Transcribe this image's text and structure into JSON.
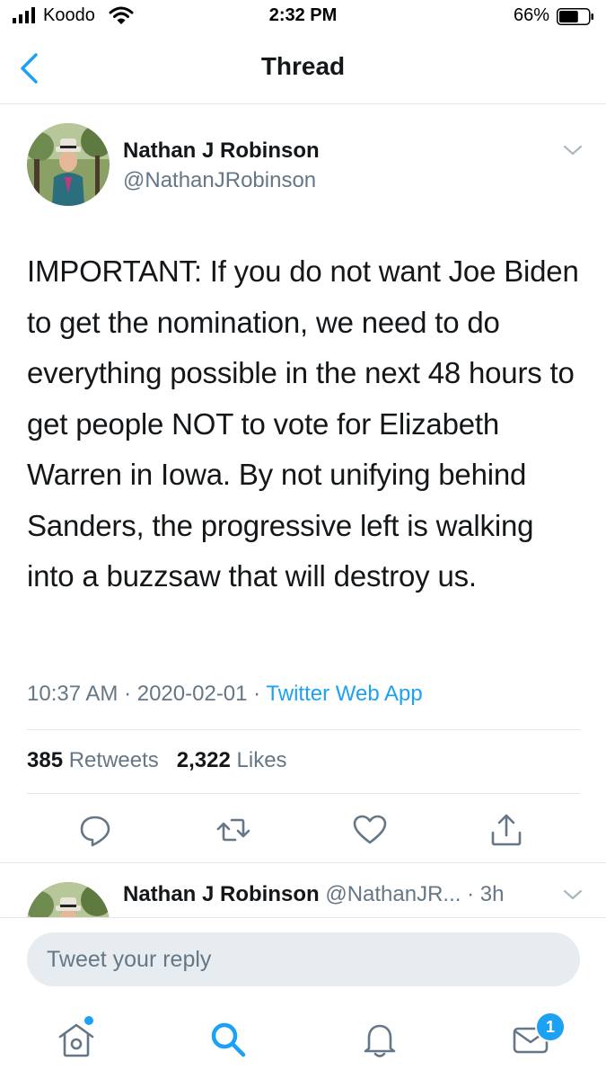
{
  "status_bar": {
    "carrier": "Koodo",
    "time": "2:32 PM",
    "battery_percent": "66%",
    "battery_level": 0.66
  },
  "nav": {
    "title": "Thread",
    "back_icon": "chevron-left-icon"
  },
  "tweet": {
    "author_name": "Nathan J Robinson",
    "author_handle": "@NathanJRobinson",
    "text": "IMPORTANT: If you do not want Joe Biden to get the nomination, we need to do everything possible in the next 48 hours to get people NOT to vote for Elizabeth Warren in Iowa. By not unifying behind Sanders, the progressive left is walking into a buzzsaw that will destroy us.",
    "time": "10:37 AM",
    "date": "2020-02-01",
    "separator": " · ",
    "source": "Twitter Web App",
    "retweets_count": "385",
    "retweets_label": "Retweets",
    "likes_count": "2,322",
    "likes_label": "Likes"
  },
  "actions": [
    "reply-icon",
    "retweet-icon",
    "like-icon",
    "share-icon"
  ],
  "next_tweet": {
    "author_name": "Nathan J Robinson",
    "author_handle": "@NathanJR...",
    "age": "· 3h"
  },
  "reply": {
    "placeholder": "Tweet your reply"
  },
  "tab_bar": {
    "tabs": [
      "home-icon",
      "search-icon",
      "notifications-icon",
      "messages-icon"
    ],
    "messages_badge": "1"
  },
  "colors": {
    "accent": "#1da1f2",
    "text": "#14171a",
    "muted": "#657786",
    "divider": "#e1e8ed"
  }
}
